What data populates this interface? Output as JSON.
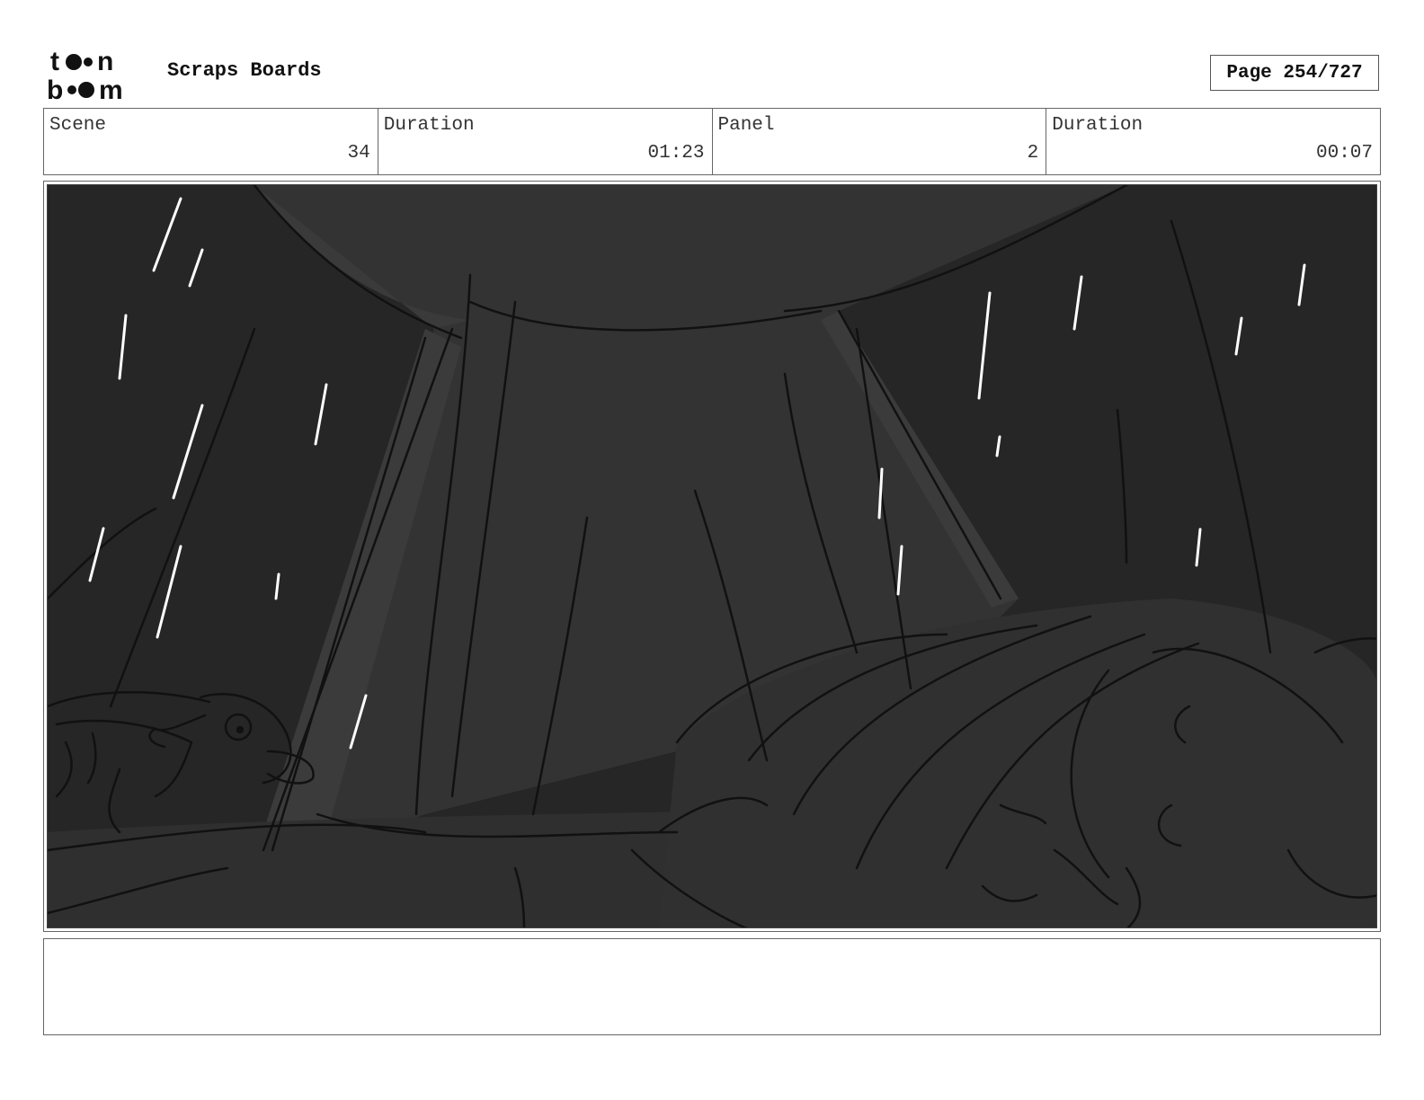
{
  "header": {
    "logo_text_top": "toon",
    "logo_text_bottom": "boom",
    "title": "Scraps Boards",
    "page": "Page 254/727"
  },
  "info": [
    {
      "label": "Scene",
      "value": "34"
    },
    {
      "label": "Duration",
      "value": "01:23"
    },
    {
      "label": "Panel",
      "value": "2"
    },
    {
      "label": "Duration",
      "value": "00:07"
    }
  ],
  "notes": {
    "text": ""
  },
  "colors": {
    "sky_dark": "#262626",
    "tent": "#333333",
    "tent_edge": "#3a3a3a",
    "ground": "#2f2f2f",
    "rain": "#ffffff",
    "ink": "#111111"
  }
}
